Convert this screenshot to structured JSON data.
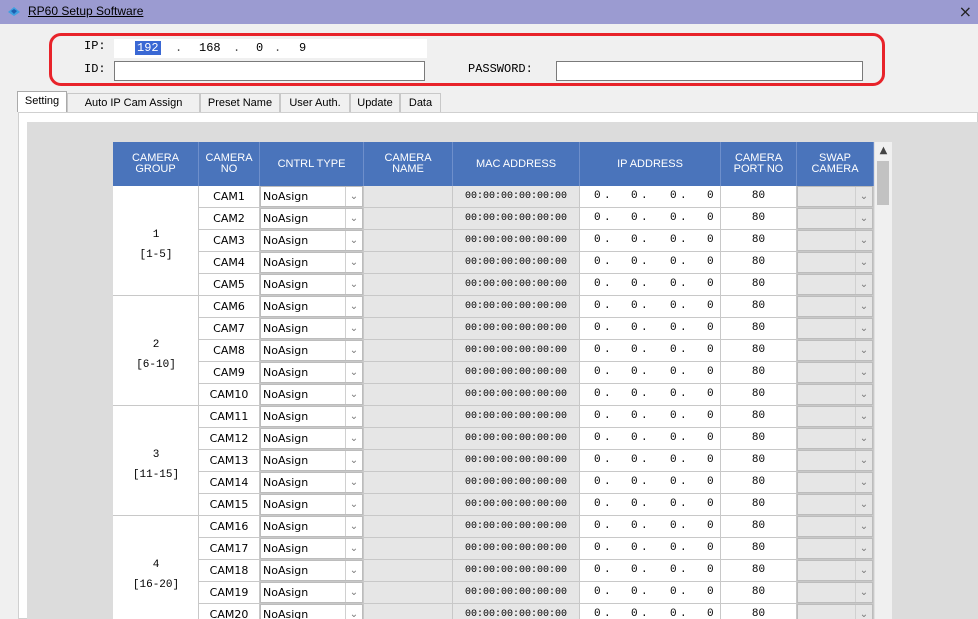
{
  "window": {
    "title": "RP60 Setup Software",
    "close": "×"
  },
  "connection": {
    "ip_label": "IP:",
    "ip": [
      "192",
      "168",
      "0",
      "9"
    ],
    "id_label": "ID:",
    "id_value": "",
    "password_label": "PASSWORD:",
    "password_value": "",
    "highlight_color": "#e8232a"
  },
  "tabs": [
    "Setting",
    "Auto IP Cam Assign",
    "Preset Name",
    "User Auth.",
    "Update",
    "Data"
  ],
  "active_tab": "Setting",
  "table": {
    "header_color": "#4a74bb",
    "columns": [
      {
        "l1": "CAMERA",
        "l2": "GROUP"
      },
      {
        "l1": "CAMERA",
        "l2": "NO"
      },
      {
        "l1": "CNTRL TYPE",
        "l2": ""
      },
      {
        "l1": "CAMERA",
        "l2": "NAME"
      },
      {
        "l1": "MAC ADDRESS",
        "l2": ""
      },
      {
        "l1": "IP ADDRESS",
        "l2": ""
      },
      {
        "l1": "CAMERA",
        "l2": "PORT NO"
      },
      {
        "l1": "SWAP",
        "l2": "CAMERA"
      }
    ],
    "groups": [
      {
        "num": "1",
        "range": "[1-5]"
      },
      {
        "num": "2",
        "range": "[6-10]"
      },
      {
        "num": "3",
        "range": "[11-15]"
      },
      {
        "num": "4",
        "range": "[16-20]"
      }
    ],
    "rows": [
      {
        "no": "CAM1",
        "type": "NoAsign",
        "mac": "00:00:00:00:00:00",
        "ip": [
          "0",
          "0",
          "0",
          "0"
        ],
        "port": "80"
      },
      {
        "no": "CAM2",
        "type": "NoAsign",
        "mac": "00:00:00:00:00:00",
        "ip": [
          "0",
          "0",
          "0",
          "0"
        ],
        "port": "80"
      },
      {
        "no": "CAM3",
        "type": "NoAsign",
        "mac": "00:00:00:00:00:00",
        "ip": [
          "0",
          "0",
          "0",
          "0"
        ],
        "port": "80"
      },
      {
        "no": "CAM4",
        "type": "NoAsign",
        "mac": "00:00:00:00:00:00",
        "ip": [
          "0",
          "0",
          "0",
          "0"
        ],
        "port": "80"
      },
      {
        "no": "CAM5",
        "type": "NoAsign",
        "mac": "00:00:00:00:00:00",
        "ip": [
          "0",
          "0",
          "0",
          "0"
        ],
        "port": "80"
      },
      {
        "no": "CAM6",
        "type": "NoAsign",
        "mac": "00:00:00:00:00:00",
        "ip": [
          "0",
          "0",
          "0",
          "0"
        ],
        "port": "80"
      },
      {
        "no": "CAM7",
        "type": "NoAsign",
        "mac": "00:00:00:00:00:00",
        "ip": [
          "0",
          "0",
          "0",
          "0"
        ],
        "port": "80"
      },
      {
        "no": "CAM8",
        "type": "NoAsign",
        "mac": "00:00:00:00:00:00",
        "ip": [
          "0",
          "0",
          "0",
          "0"
        ],
        "port": "80"
      },
      {
        "no": "CAM9",
        "type": "NoAsign",
        "mac": "00:00:00:00:00:00",
        "ip": [
          "0",
          "0",
          "0",
          "0"
        ],
        "port": "80"
      },
      {
        "no": "CAM10",
        "type": "NoAsign",
        "mac": "00:00:00:00:00:00",
        "ip": [
          "0",
          "0",
          "0",
          "0"
        ],
        "port": "80"
      },
      {
        "no": "CAM11",
        "type": "NoAsign",
        "mac": "00:00:00:00:00:00",
        "ip": [
          "0",
          "0",
          "0",
          "0"
        ],
        "port": "80"
      },
      {
        "no": "CAM12",
        "type": "NoAsign",
        "mac": "00:00:00:00:00:00",
        "ip": [
          "0",
          "0",
          "0",
          "0"
        ],
        "port": "80"
      },
      {
        "no": "CAM13",
        "type": "NoAsign",
        "mac": "00:00:00:00:00:00",
        "ip": [
          "0",
          "0",
          "0",
          "0"
        ],
        "port": "80"
      },
      {
        "no": "CAM14",
        "type": "NoAsign",
        "mac": "00:00:00:00:00:00",
        "ip": [
          "0",
          "0",
          "0",
          "0"
        ],
        "port": "80"
      },
      {
        "no": "CAM15",
        "type": "NoAsign",
        "mac": "00:00:00:00:00:00",
        "ip": [
          "0",
          "0",
          "0",
          "0"
        ],
        "port": "80"
      },
      {
        "no": "CAM16",
        "type": "NoAsign",
        "mac": "00:00:00:00:00:00",
        "ip": [
          "0",
          "0",
          "0",
          "0"
        ],
        "port": "80"
      },
      {
        "no": "CAM17",
        "type": "NoAsign",
        "mac": "00:00:00:00:00:00",
        "ip": [
          "0",
          "0",
          "0",
          "0"
        ],
        "port": "80"
      },
      {
        "no": "CAM18",
        "type": "NoAsign",
        "mac": "00:00:00:00:00:00",
        "ip": [
          "0",
          "0",
          "0",
          "0"
        ],
        "port": "80"
      },
      {
        "no": "CAM19",
        "type": "NoAsign",
        "mac": "00:00:00:00:00:00",
        "ip": [
          "0",
          "0",
          "0",
          "0"
        ],
        "port": "80"
      },
      {
        "no": "CAM20",
        "type": "NoAsign",
        "mac": "00:00:00:00:00:00",
        "ip": [
          "0",
          "0",
          "0",
          "0"
        ],
        "port": "80"
      }
    ]
  },
  "icons": {
    "dropdown": "chevron-down-icon",
    "scroll_up": "scroll-up-icon",
    "app": "app-icon"
  }
}
